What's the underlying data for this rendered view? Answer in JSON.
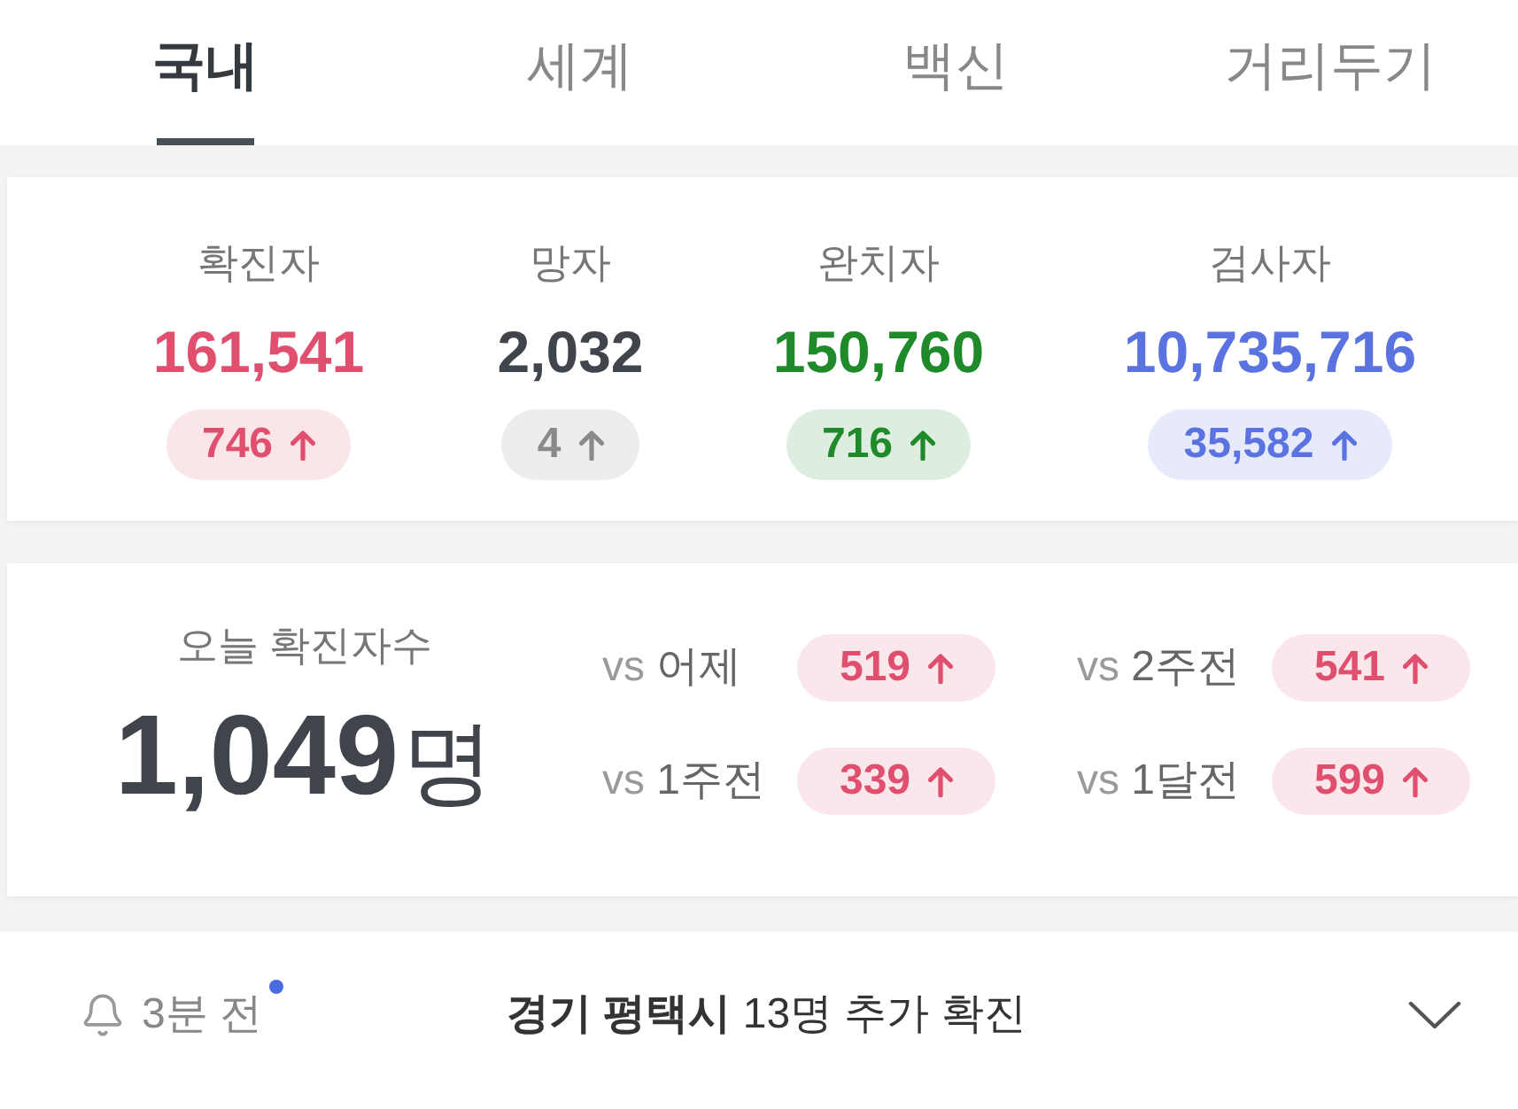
{
  "tabs": [
    {
      "label": "국내",
      "selected": true
    },
    {
      "label": "세계",
      "selected": false
    },
    {
      "label": "백신",
      "selected": false
    },
    {
      "label": "거리두기",
      "selected": false
    }
  ],
  "totals": [
    {
      "label": "확진자",
      "value": "161,541",
      "color": "#e0506e",
      "change": {
        "text": "746",
        "color": "#e0506e"
      }
    },
    {
      "label": "망자",
      "value": "2,032",
      "color": "#3f454b",
      "change": {
        "text": "4",
        "color": "#8a8a8a"
      }
    },
    {
      "label": "완치자",
      "value": "150,760",
      "color": "#1e8a2a",
      "change": {
        "text": "716",
        "color": "#1e8a2a"
      }
    },
    {
      "label": "검사자",
      "value": "10,735,716",
      "color": "#5b73e0",
      "change": {
        "text": "35,582",
        "color": "#5b73e0"
      }
    }
  ],
  "today": {
    "label": "오늘 확진자수",
    "value": "1,049",
    "unit": "명",
    "comparisons": [
      {
        "prefix": "vs",
        "label": "어제",
        "change": "519"
      },
      {
        "prefix": "vs",
        "label": "2주전",
        "change": "541"
      },
      {
        "prefix": "vs",
        "label": "1주전",
        "change": "339"
      },
      {
        "prefix": "vs",
        "label": "1달전",
        "change": "599"
      }
    ]
  },
  "notice": {
    "time": "3분 전",
    "unread": true,
    "text": "**경기 평택시** 13명 추가 확진",
    "expanded": false
  }
}
